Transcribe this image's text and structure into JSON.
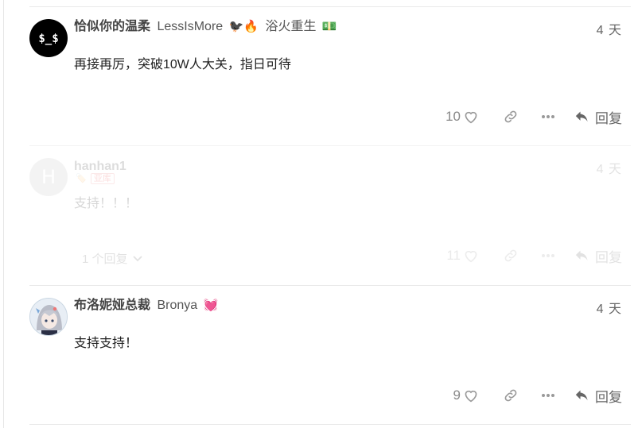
{
  "posts": [
    {
      "username": "恰似你的温柔",
      "full_name": "LessIsMore",
      "flair": "🐦‍⬛🔥",
      "title": "浴火重生",
      "title_emoji": "💵",
      "date": "4 天",
      "content": "再接再厉，突破10W人大关，指日可待",
      "likes": "10",
      "reply_label": "回复"
    },
    {
      "username": "hanhan1",
      "flair": "🏷️",
      "badge": "亚库",
      "date": "4 天",
      "content": "支持！！！",
      "replies_toggle": "1 个回复",
      "likes": "11",
      "reply_label": "回复"
    },
    {
      "username": "布洛妮娅总裁",
      "full_name": "Bronya",
      "flair": "💓",
      "date": "4 天",
      "content": "支持支持！",
      "likes": "9",
      "reply_label": "回复"
    }
  ],
  "colors": {
    "text": "#222222",
    "muted": "#888888",
    "divider": "#e9e9e9"
  },
  "icons": [
    "heart-icon",
    "link-icon",
    "more-icon",
    "reply-icon",
    "chevron-down-icon"
  ]
}
